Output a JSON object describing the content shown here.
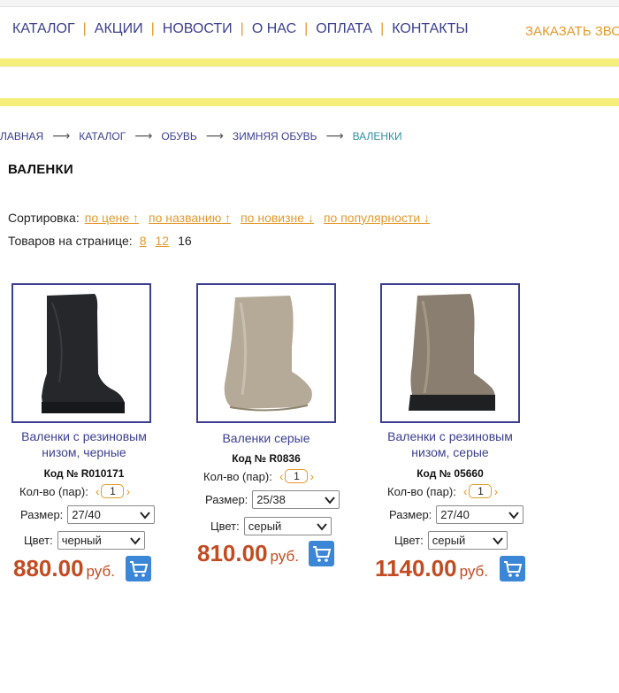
{
  "nav": {
    "items": [
      "КАТАЛОГ",
      "АКЦИИ",
      "НОВОСТИ",
      "О НАС",
      "ОПЛАТА",
      "КОНТАКТЫ"
    ],
    "order_call": "ЗАКАЗАТЬ ЗВО"
  },
  "breadcrumb": {
    "items": [
      "ЛАВНАЯ",
      "КАТАЛОГ",
      "ОБУВЬ",
      "ЗИМНЯЯ ОБУВЬ",
      "ВАЛЕНКИ"
    ]
  },
  "page": {
    "title": "ВАЛЕНКИ"
  },
  "sort": {
    "label": "Сортировка:",
    "options": [
      "по цене ↑",
      "по названию ↑",
      "по новизне ↓",
      "по популярности ↓"
    ]
  },
  "per_page": {
    "label": "Товаров на странице:",
    "options": [
      "8",
      "12"
    ],
    "current": "16"
  },
  "product_labels": {
    "qty": "Кол-во (пар):",
    "size": "Размер:",
    "color": "Цвет:",
    "currency": "руб."
  },
  "products": [
    {
      "name_line1": "Валенки с резиновым",
      "name_line2": "низом, черные",
      "code": "Код № R010171",
      "qty": "1",
      "size": "27/40",
      "color": "черный",
      "price": "880.00",
      "image": "black-felt-boot-with-rubber-sole"
    },
    {
      "name_line1": "Валенки серые",
      "name_line2": "",
      "code": "Код № R0836",
      "qty": "1",
      "size": "25/38",
      "color": "серый",
      "price": "810.00",
      "image": "grey-felt-boot"
    },
    {
      "name_line1": "Валенки с резиновым",
      "name_line2": "низом, серые",
      "code": "Код № 05660",
      "qty": "1",
      "size": "27/40",
      "color": "серый",
      "price": "1140.00",
      "image": "grey-felt-boot-with-rubber-sole"
    }
  ],
  "colors": {
    "nav_text": "#3b3f8f",
    "accent_orange": "#e39a2d",
    "band_yellow": "#f6ee7a",
    "price_red": "#c24b22",
    "cart_blue": "#3b86d6"
  }
}
